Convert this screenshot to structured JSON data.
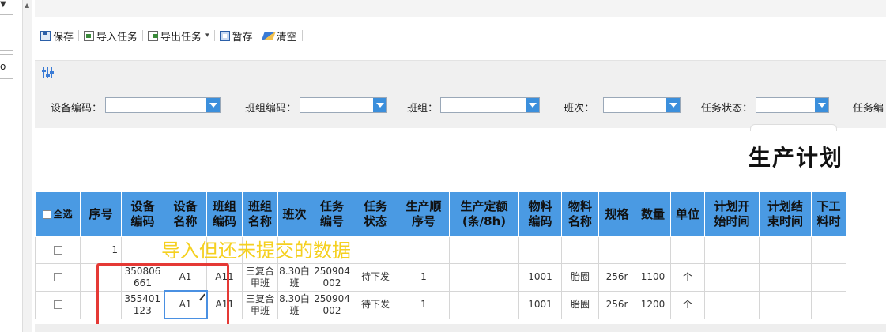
{
  "left_panel": {
    "select_text": "o"
  },
  "toolbar": {
    "save_label": "保存",
    "import_label": "导入任务",
    "export_label": "导出任务",
    "stash_label": "暂存",
    "clear_label": "清空"
  },
  "filters": {
    "device_code_label": "设备编码：",
    "team_code_label": "班组编码：",
    "team_label": "班组：",
    "shift_label": "班次：",
    "task_status_label": "任务状态：",
    "task_more_label": "任务编"
  },
  "page_title": "生产计划",
  "table": {
    "select_all_label": "全选",
    "headers": [
      "序号",
      "设备\n编码",
      "设备\n名称",
      "班组\n编码",
      "班组\n名称",
      "班次",
      "任务\n编号",
      "任务\n状态",
      "生产顺\n序号",
      "生产定额\n(条/8h)",
      "物料\n编码",
      "物料\n名称",
      "规格",
      "数量",
      "单位",
      "计划开\n始时间",
      "计划结\n束时间",
      "下工\n料时"
    ],
    "rows": [
      {
        "seq": "1",
        "device_code": "",
        "device_name": "",
        "team_code": "",
        "team_name": "",
        "shift": "",
        "task_no": "",
        "task_status": "",
        "prod_seq": "",
        "quota": "",
        "material_code": "",
        "material_name": "",
        "spec": "",
        "qty": "",
        "unit": "",
        "start": "",
        "end": "",
        "next": ""
      },
      {
        "seq": "",
        "device_code": "350806661",
        "device_name": "A1",
        "team_code": "A11",
        "team_name": "三复合甲班",
        "shift": "8.30白班",
        "task_no": "250904002",
        "task_status": "待下发",
        "prod_seq": "1",
        "quota": "",
        "material_code": "1001",
        "material_name": "胎圈",
        "spec": "256r",
        "qty": "1100",
        "unit": "个",
        "start": "",
        "end": "",
        "next": ""
      },
      {
        "seq": "",
        "device_code": "355401123",
        "device_name": "A1",
        "team_code": "A11",
        "team_name": "三复合甲班",
        "shift": "8.30白班",
        "task_no": "250904002",
        "task_status": "待下发",
        "prod_seq": "1",
        "quota": "",
        "material_code": "1001",
        "material_name": "胎圈",
        "spec": "256r",
        "qty": "1200",
        "unit": "个",
        "start": "",
        "end": "",
        "next": ""
      }
    ]
  },
  "annotation": {
    "text": "导入但还未提交的数据",
    "color": "#f5d020",
    "box_color": "#e53935"
  },
  "colors": {
    "header_bg": "#4a9ae3",
    "select_button": "#3b8fdc",
    "filter_bg": "#f0f0f0"
  }
}
